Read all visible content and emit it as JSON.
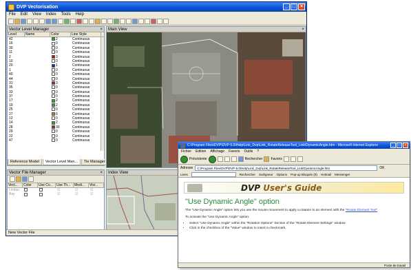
{
  "dvp": {
    "title": "DVP Vectorisation",
    "menu": [
      "File",
      "Edit",
      "View",
      "Index",
      "Tools",
      "Help"
    ],
    "vlm": {
      "title": "Vector Level Manager",
      "columns": [
        "Level",
        "Name",
        "Color",
        "Line Style"
      ],
      "rows": [
        {
          "level": "42",
          "color": "#3aa03a",
          "num": "2",
          "style": "Continuous"
        },
        {
          "level": "16",
          "color": "#ffffff",
          "num": "0",
          "style": "Continuous"
        },
        {
          "level": "30",
          "color": "#ffffff",
          "num": "0",
          "style": "Continuous"
        },
        {
          "level": "11",
          "color": "#ffffff",
          "num": "0",
          "style": "Continuous"
        },
        {
          "level": "2",
          "color": "#b02020",
          "num": "3",
          "style": "Continuous"
        },
        {
          "level": "10",
          "color": "#ffffff",
          "num": "0",
          "style": "Continuous"
        },
        {
          "level": "20",
          "color": "#2030b0",
          "num": "1",
          "style": "Continuous"
        },
        {
          "level": "1",
          "color": "#ffffff",
          "num": "0",
          "style": "Continuous"
        },
        {
          "level": "40",
          "color": "#ffffff",
          "num": "0",
          "style": "Continuous"
        },
        {
          "level": "44",
          "color": "#ffffff",
          "num": "0",
          "style": "Continuous"
        },
        {
          "level": "31",
          "color": "#b02020",
          "num": "3",
          "style": "Continuous"
        },
        {
          "level": "35",
          "color": "#ffffff",
          "num": "0",
          "style": "Continuous"
        },
        {
          "level": "33",
          "color": "#ffffff",
          "num": "0",
          "style": "Continuous"
        },
        {
          "level": "37",
          "color": "#ffffff",
          "num": "0",
          "style": "Continuous"
        },
        {
          "level": "17",
          "color": "#3aa03a",
          "num": "2",
          "style": "Continuous"
        },
        {
          "level": "19",
          "color": "#3aa03a",
          "num": "2",
          "style": "Continuous"
        },
        {
          "level": "25",
          "color": "#ffffff",
          "num": "0",
          "style": "Continuous"
        },
        {
          "level": "27",
          "color": "#c07a30",
          "num": "6",
          "style": "Continuous"
        },
        {
          "level": "12",
          "color": "#ffffff",
          "num": "0",
          "style": "Continuous"
        },
        {
          "level": "14",
          "color": "#3aa03a",
          "num": "2",
          "style": "Continuous"
        },
        {
          "level": "28",
          "color": "#8a3030",
          "num": "30",
          "style": "Continuous"
        },
        {
          "level": "29",
          "color": "#ffffff",
          "num": "0",
          "style": "Continuous"
        },
        {
          "level": "22",
          "color": "#ffffff",
          "num": "0",
          "style": "Continuous"
        },
        {
          "level": "47",
          "color": "#ffffff",
          "num": "0",
          "style": "Continuous"
        }
      ],
      "tabs": [
        "Reference Model",
        "Vector Level Man...",
        "Tie Manager"
      ]
    },
    "mainview_title": "Main View",
    "vfm": {
      "title": "Vector File Manager",
      "columns": [
        "Vect...",
        "Color",
        "Use Co...",
        "Use Th...",
        "Modi...",
        "Visi..."
      ],
      "rows": [
        {
          "name": "Lindau",
          "color": "#ffffff"
        },
        {
          "name": "Bay",
          "color": "#ffffff"
        }
      ]
    },
    "indexview_title": "Index View",
    "status": "New Vector File"
  },
  "browser": {
    "title": "C:\\Program Files\\DVP\\DVP-5.0\\Help\\Link_Dvp\\Link_RotateReleaseTool_Link\\DynamicAngle.htm - Microsoft Internet Explorer",
    "menu": [
      "Fichier",
      "Edition",
      "Affichage",
      "Favoris",
      "Outils",
      "?"
    ],
    "toolbar": [
      "Précédente",
      "Rechercher",
      "Favoris"
    ],
    "address_label": "Adresse",
    "address": "C:\\Program Files\\DVP\\DVP-5.0\\Help\\Link_Dvp\\Link_RotateReleaseTool_Link\\DynamicAngle.htm",
    "go_label": "OK",
    "links_label": "Liens",
    "links": [
      "Rechercher",
      "Surligneur",
      "Options",
      "Pop-up Bloqués (0)",
      "Hotmail",
      "Messenger"
    ],
    "guide_title_1": "DVP",
    "guide_title_2": "User's Guide",
    "heading": "\"Use Dynamic Angle\" option",
    "para1": "The \"Use Dynamic Angle\" option lets you use the mouse movement to apply a rotation to an element with the",
    "para1_link": "\"Rotate Element Tool\"",
    "para2": "To activate the \"Use Dynamic Angle\" option:",
    "bullet1": "Select \"Use Dynamic Angle\" within the \"Rotation Options\" Section of the \"Rotate Element Settings\" window",
    "bullet2": "Click in the checkbox of the \"Value\" window to insert a checkmark.",
    "status": "Poste de travail"
  }
}
